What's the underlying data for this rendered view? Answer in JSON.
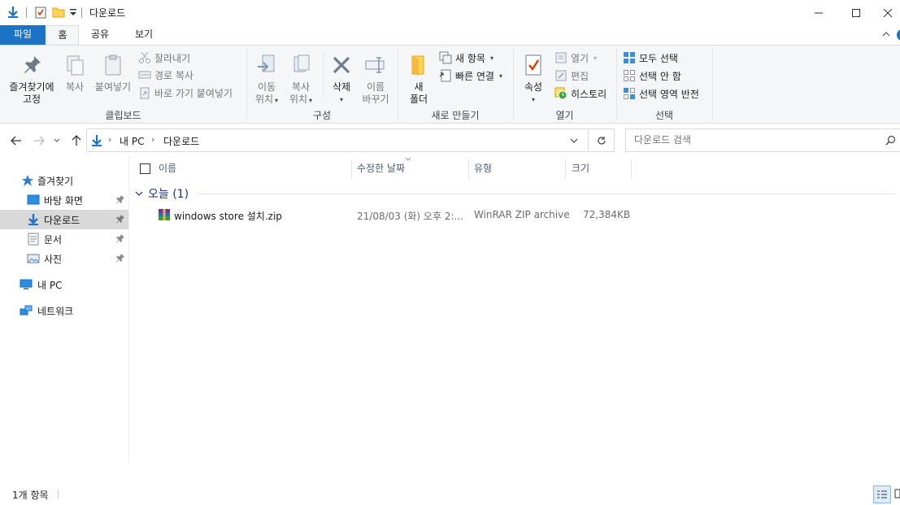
{
  "window": {
    "title": "다운로드",
    "minimize_icon": "minimize-icon",
    "maximize_icon": "maximize-icon",
    "close_icon": "close-icon"
  },
  "tabs": [
    {
      "label": "파일"
    },
    {
      "label": "홈"
    },
    {
      "label": "공유"
    },
    {
      "label": "보기"
    }
  ],
  "ribbon": {
    "clipboard": {
      "label": "클립보드",
      "pin_line1": "즐겨찾기에",
      "pin_line2": "고정",
      "copy": "복사",
      "paste": "붙여넣기",
      "cut": "잘라내기",
      "copy_path": "경로 복사",
      "paste_shortcut": "바로 가기 붙여넣기"
    },
    "organize": {
      "label": "구성",
      "move_line1": "이동",
      "move_line2": "위치",
      "copyto_line1": "복사",
      "copyto_line2": "위치",
      "delete": "삭제",
      "rename_line1": "이름",
      "rename_line2": "바꾸기"
    },
    "new": {
      "label": "새로 만들기",
      "folder_line1": "새",
      "folder_line2": "폴더",
      "new_item": "새 항목",
      "easy_access": "빠른 연결"
    },
    "open": {
      "label": "열기",
      "properties": "속성",
      "open": "열기",
      "edit": "편집",
      "history": "히스토리"
    },
    "select": {
      "label": "선택",
      "select_all": "모두 선택",
      "select_none": "선택 안 함",
      "invert": "선택 영역 반전"
    }
  },
  "address": {
    "segments": [
      "내 PC",
      "다운로드"
    ],
    "search_placeholder": "다운로드 검색"
  },
  "nav": {
    "quick_access": "즐겨찾기",
    "desktop": "바탕 화면",
    "downloads": "다운로드",
    "documents": "문서",
    "pictures": "사진",
    "this_pc": "내 PC",
    "network": "네트워크"
  },
  "columns": {
    "name": "이름",
    "modified": "수정한 날짜",
    "type": "유형",
    "size": "크기"
  },
  "group": {
    "label": "오늘 (1)"
  },
  "files": [
    {
      "name": "windows store 설치.zip",
      "modified": "21/08/03 (화) 오후 2:...",
      "type": "WinRAR ZIP archive",
      "size": "72,384KB"
    }
  ],
  "status": {
    "count": "1개 항목"
  },
  "colors": {
    "accent": "#1a73c6",
    "selected_nav": "#d9d9d9",
    "group_header": "#1e3287",
    "column_header": "#4c607a"
  }
}
